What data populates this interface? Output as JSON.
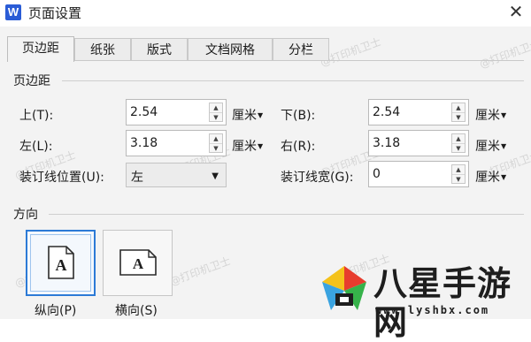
{
  "window": {
    "app_icon": "W",
    "title": "页面设置",
    "close_glyph": "✕"
  },
  "tabs": [
    {
      "label": "页边距",
      "active": true
    },
    {
      "label": "纸张",
      "active": false
    },
    {
      "label": "版式",
      "active": false
    },
    {
      "label": "文档网格",
      "active": false
    },
    {
      "label": "分栏",
      "active": false
    }
  ],
  "margins": {
    "group_label": "页边距",
    "top_label": "上(T):",
    "top_value": "2.54",
    "top_unit": "厘米",
    "bottom_label": "下(B):",
    "bottom_value": "2.54",
    "bottom_unit": "厘米",
    "left_label": "左(L):",
    "left_value": "3.18",
    "left_unit": "厘米",
    "right_label": "右(R):",
    "right_value": "3.18",
    "right_unit": "厘米",
    "gutter_pos_label": "装订线位置(U):",
    "gutter_pos_value": "左",
    "gutter_width_label": "装订线宽(G):",
    "gutter_width_value": "0",
    "gutter_width_unit": "厘米"
  },
  "orientation": {
    "group_label": "方向",
    "portrait_label": "纵向(P)",
    "landscape_label": "横向(S)",
    "page_glyph": "A",
    "selected": "portrait"
  },
  "watermark_text": "@打印机卫士",
  "logo": {
    "text": "八星手游网",
    "url": "www.lyshbx.com"
  },
  "colors": {
    "selected_border": "#2c7ad6",
    "app_icon_bg": "#2a5cd6"
  }
}
